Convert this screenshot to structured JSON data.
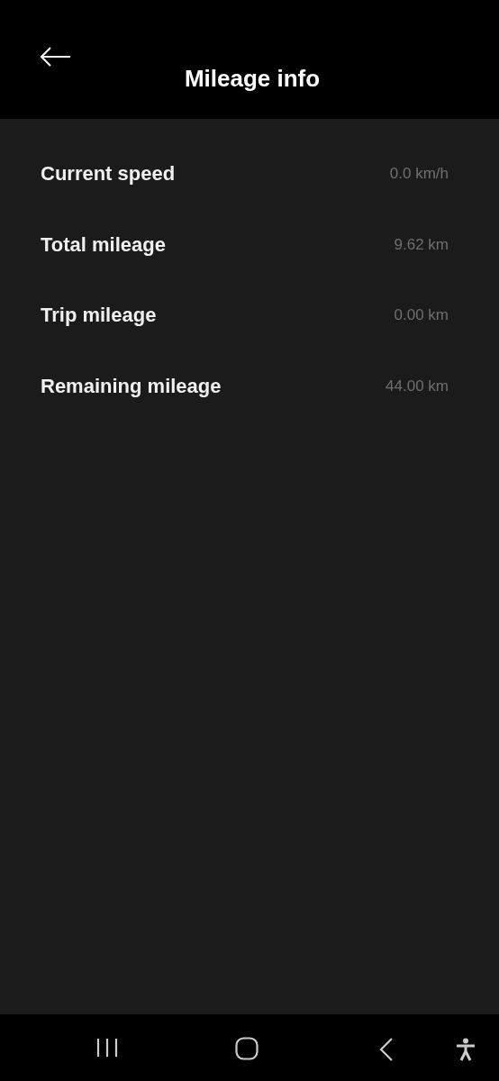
{
  "header": {
    "title": "Mileage info"
  },
  "rows": [
    {
      "label": "Current speed",
      "value": "0.0 km/h"
    },
    {
      "label": "Total mileage",
      "value": "9.62 km"
    },
    {
      "label": "Trip mileage",
      "value": "0.00 km"
    },
    {
      "label": "Remaining mileage",
      "value": "44.00 km"
    }
  ]
}
